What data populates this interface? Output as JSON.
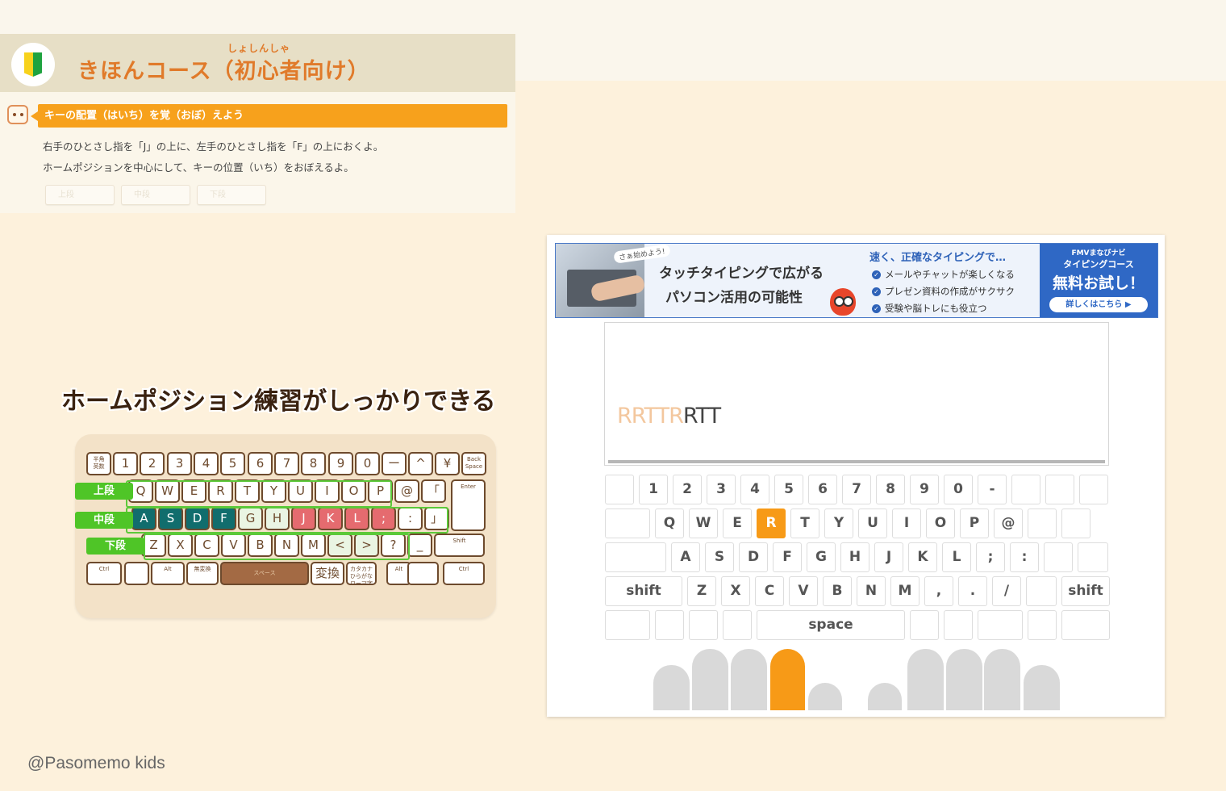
{
  "course": {
    "title": "きほんコース（初心者向け）",
    "ruby": "しょしんしゃ",
    "lesson_title": "キーの配置（はいち）を覚（おぼ）えよう",
    "instructions": [
      "右手のひとさし指を「J」の上に、左手のひとさし指を「F」の上におくよ。",
      "ホームポジションを中心にして、キーの位置（いち）をおぼえるよ。"
    ],
    "row_tabs": [
      "上段",
      "中段",
      "下段"
    ]
  },
  "caption": "ホームポジション練習がしっかりできる",
  "illustration": {
    "row_labels": [
      "上段",
      "中段",
      "下段"
    ],
    "rows": [
      [
        "半角\n英数",
        "1",
        "2",
        "3",
        "4",
        "5",
        "6",
        "7",
        "8",
        "9",
        "0",
        "ー",
        "^",
        "¥",
        "Back\nSpace"
      ],
      [
        "Q",
        "W",
        "E",
        "R",
        "T",
        "Y",
        "U",
        "I",
        "O",
        "P",
        "@",
        "「",
        "Enter"
      ],
      [
        "A",
        "S",
        "D",
        "F",
        "G",
        "H",
        "J",
        "K",
        "L",
        ";",
        ":",
        "」"
      ],
      [
        "Z",
        "X",
        "C",
        "V",
        "B",
        "N",
        "M",
        "<",
        ">",
        "?",
        "_",
        "Shift"
      ],
      [
        "Ctrl",
        "",
        "Alt",
        "無変換",
        "スペース",
        "変換",
        "カタカナ\nひらがな\nローマ字",
        "Alt",
        "",
        "Ctrl"
      ]
    ]
  },
  "ad": {
    "lets_start": "さぁ始めよう!",
    "headline_1": "タッチタイピングで広がる",
    "headline_2": "パソコン活用の可能性",
    "subhead": "速く、正確なタイピングで…",
    "bullets": [
      "メールやチャットが楽しくなる",
      "プレゼン資料の作成がサクサク",
      "受験や脳トレにも役立つ"
    ],
    "brand_line_1": "FMVまなびナビ",
    "brand_line_2": "タイピングコース",
    "offer": "無料お試し！",
    "cta": "詳しくはこちら ▶",
    "check_icon": "check-circle-icon"
  },
  "typing": {
    "typed": "RRTTR",
    "remaining": "RTT"
  },
  "virtual_keyboard": {
    "row1": [
      "",
      "1",
      "2",
      "3",
      "4",
      "5",
      "6",
      "7",
      "8",
      "9",
      "0",
      "-",
      "",
      "",
      ""
    ],
    "row2": [
      "",
      "Q",
      "W",
      "E",
      "R",
      "T",
      "Y",
      "U",
      "I",
      "O",
      "P",
      "@",
      "",
      ""
    ],
    "row3": [
      "",
      "A",
      "S",
      "D",
      "F",
      "G",
      "H",
      "J",
      "K",
      "L",
      ";",
      ":",
      "",
      ""
    ],
    "row4": [
      "shift",
      "Z",
      "X",
      "C",
      "V",
      "B",
      "N",
      "M",
      ",",
      ".",
      "/",
      "",
      "shift"
    ],
    "row5": [
      "",
      "",
      "",
      "",
      "space",
      "",
      "",
      "",
      "",
      ""
    ],
    "active_key": "R",
    "active_color": "#f79a17"
  },
  "fingers": {
    "active_index": 3
  },
  "credit": "@Pasomemo kids"
}
